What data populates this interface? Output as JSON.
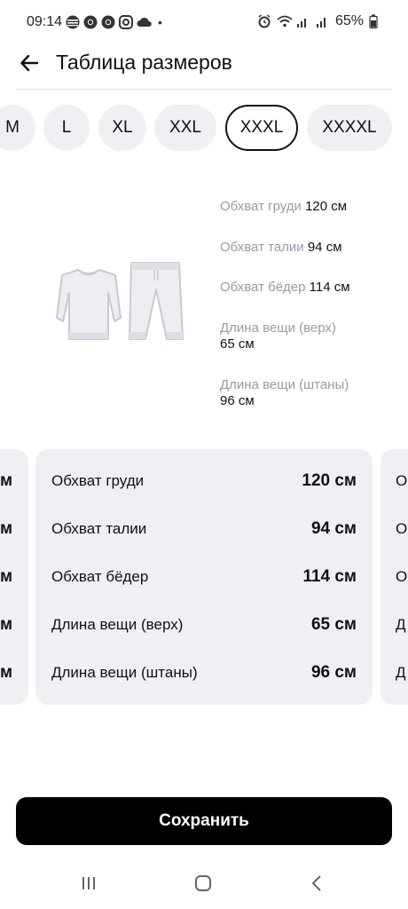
{
  "status_bar": {
    "time": "09:14",
    "dot": "•",
    "battery": "65%",
    "left_icons": [
      "app-icon",
      "chrome-icon",
      "chrome-icon",
      "instagram-icon",
      "cloud-icon"
    ],
    "right_icons": [
      "alarm-icon",
      "wifi-icon",
      "signal-icon",
      "signal-icon",
      "battery-icon"
    ]
  },
  "header": {
    "title": "Таблица размеров",
    "back_icon": "arrow-left-icon"
  },
  "size_tabs": [
    {
      "label": "M",
      "selected": false
    },
    {
      "label": "L",
      "selected": false
    },
    {
      "label": "XL",
      "selected": false
    },
    {
      "label": "XXL",
      "selected": false
    },
    {
      "label": "XXXL",
      "selected": true
    },
    {
      "label": "XXXXL",
      "selected": false
    }
  ],
  "preview": [
    {
      "label": "Обхват груди",
      "value": "120 см"
    },
    {
      "label": "Обхват талии",
      "value": "94 см"
    },
    {
      "label": "Обхват бёдер",
      "value": "114 см"
    },
    {
      "label": "Длина вещи (верх)",
      "value": "65 см"
    },
    {
      "label": "Длина вещи (штаны)",
      "value": "96 см"
    }
  ],
  "table": {
    "rows": [
      {
        "label": "Обхват груди",
        "value": "120 см"
      },
      {
        "label": "Обхват талии",
        "value": "94 см"
      },
      {
        "label": "Обхват бёдер",
        "value": "114 см"
      },
      {
        "label": "Длина вещи (верх)",
        "value": "65 см"
      },
      {
        "label": "Длина вещи (штаны)",
        "value": "96 см"
      }
    ],
    "left_card_values": [
      "м",
      "м",
      "м",
      "м",
      "м"
    ],
    "right_card_labels": [
      "Об",
      "Об",
      "Об",
      "Д",
      "Д"
    ]
  },
  "save_button": "Сохранить",
  "nav": {
    "icons": [
      "recent-apps-icon",
      "home-icon",
      "back-icon"
    ]
  },
  "colors": {
    "accent": "#000000",
    "chip_bg": "#f0f0f4",
    "muted_text": "#9a9aa8"
  }
}
